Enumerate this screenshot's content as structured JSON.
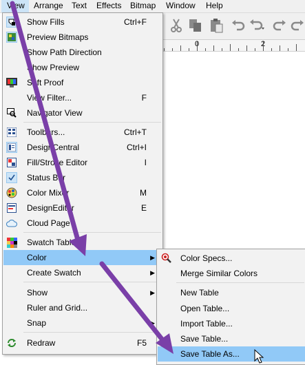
{
  "menubar": {
    "items": [
      {
        "label": "View",
        "active": true
      },
      {
        "label": "Arrange"
      },
      {
        "label": "Text"
      },
      {
        "label": "Effects"
      },
      {
        "label": "Bitmap"
      },
      {
        "label": "Window"
      },
      {
        "label": "Help"
      }
    ]
  },
  "ruler": {
    "labels": [
      "0",
      "2"
    ]
  },
  "view_menu": {
    "items": [
      {
        "label": "Show Fills",
        "shortcut": "Ctrl+F",
        "icon": "show-fills-icon"
      },
      {
        "label": "Preview Bitmaps",
        "shortcut": "",
        "icon": "preview-bitmaps-icon"
      },
      {
        "label": "Show Path Direction",
        "shortcut": ""
      },
      {
        "label": "Show Preview",
        "shortcut": ""
      },
      {
        "label": "Soft Proof",
        "shortcut": "",
        "icon": "soft-proof-icon"
      },
      {
        "label": "View Filter...",
        "shortcut": "F"
      },
      {
        "label": "Navigator View",
        "shortcut": "",
        "icon": "navigator-icon"
      },
      {
        "label": "Toolbars...",
        "shortcut": "Ctrl+T",
        "icon": "toolbars-icon"
      },
      {
        "label": "DesignCentral",
        "shortcut": "Ctrl+I",
        "icon": "design-central-icon"
      },
      {
        "label": "Fill/Stroke Editor",
        "shortcut": "I",
        "icon": "fill-stroke-icon"
      },
      {
        "label": "Status Bar",
        "shortcut": "",
        "icon": "checkmark-icon"
      },
      {
        "label": "Color Mixer",
        "shortcut": "M",
        "icon": "color-mixer-icon"
      },
      {
        "label": "DesignEditor",
        "shortcut": "E",
        "icon": "design-editor-icon"
      },
      {
        "label": "Cloud Page",
        "shortcut": "",
        "icon": "cloud-icon"
      },
      {
        "label": "Swatch Table",
        "shortcut": "",
        "icon": "swatch-icon"
      },
      {
        "label": "Color",
        "shortcut": "",
        "submenu": true
      },
      {
        "label": "Create Swatch",
        "shortcut": "",
        "submenu": true
      },
      {
        "label": "Show",
        "shortcut": "",
        "submenu": true
      },
      {
        "label": "Ruler and Grid...",
        "shortcut": ""
      },
      {
        "label": "Snap",
        "shortcut": "",
        "submenu": true
      },
      {
        "label": "Redraw",
        "shortcut": "F5",
        "icon": "redraw-icon"
      }
    ]
  },
  "color_submenu": {
    "items": [
      {
        "label": "Color Specs...",
        "icon": "color-specs-icon"
      },
      {
        "label": "Merge Similar Colors"
      },
      {
        "label": "New Table"
      },
      {
        "label": "Open Table..."
      },
      {
        "label": "Import Table..."
      },
      {
        "label": "Save Table..."
      },
      {
        "label": "Save Table As..."
      }
    ]
  },
  "colors": {
    "highlight": "#91c9f7",
    "annotation_arrow": "#7a3fa8"
  }
}
